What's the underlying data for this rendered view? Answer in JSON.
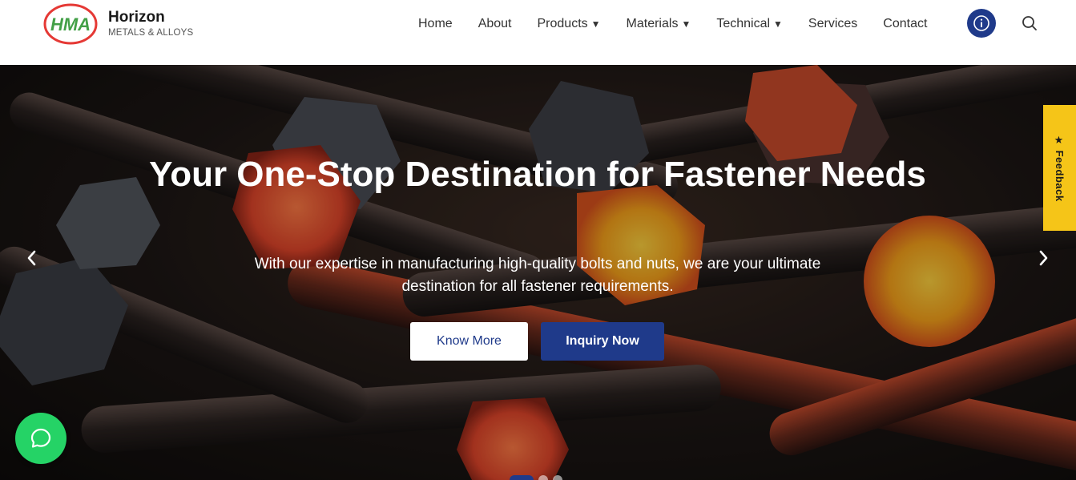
{
  "brand": {
    "name": "Horizon",
    "subtitle": "METALS & ALLOYS",
    "logo_text": "HMA"
  },
  "nav": {
    "items": [
      {
        "label": "Home",
        "dropdown": false
      },
      {
        "label": "About",
        "dropdown": false
      },
      {
        "label": "Products",
        "dropdown": true
      },
      {
        "label": "Materials",
        "dropdown": true
      },
      {
        "label": "Technical",
        "dropdown": true
      },
      {
        "label": "Services",
        "dropdown": false
      },
      {
        "label": "Contact",
        "dropdown": false
      }
    ],
    "caret": "▼",
    "info_icon": "info-icon",
    "search_icon": "search-icon"
  },
  "hero": {
    "title": "Your One-Stop Destination for Fastener Needs",
    "subtitle": "With our expertise in manufacturing high-quality bolts and nuts, we are your ultimate destination for all fastener requirements.",
    "know_more_label": "Know More",
    "inquiry_label": "Inquiry Now",
    "active_slide": 1,
    "slide_count": 3
  },
  "feedback": {
    "label": "★ Feedback"
  },
  "colors": {
    "primary": "#1f3a8a",
    "feedback": "#f5c518",
    "whatsapp": "#25d366",
    "logo_green": "#4caf50",
    "logo_red": "#e53935"
  }
}
